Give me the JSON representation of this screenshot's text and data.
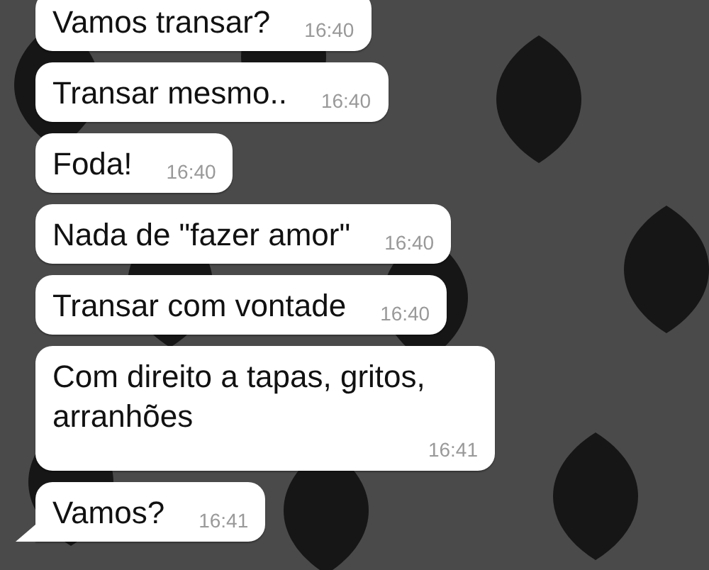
{
  "messages": [
    {
      "text": "Vamos transar?",
      "time": "16:40",
      "tail": false
    },
    {
      "text": "Transar mesmo..",
      "time": "16:40",
      "tail": false
    },
    {
      "text": "Foda!",
      "time": "16:40",
      "tail": false
    },
    {
      "text": "Nada de \"fazer amor\"",
      "time": "16:40",
      "tail": false
    },
    {
      "text": "Transar com vontade",
      "time": "16:40",
      "tail": false
    },
    {
      "text": "Com direito a tapas, gritos, arranhões",
      "time": "16:41",
      "tail": false
    },
    {
      "text": "Vamos?",
      "time": "16:41",
      "tail": true
    }
  ]
}
